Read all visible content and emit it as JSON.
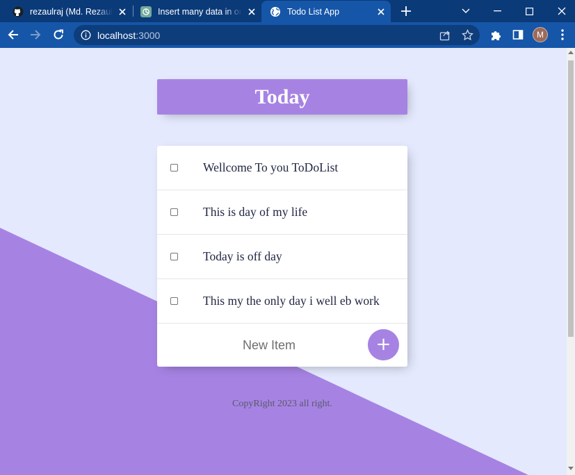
{
  "browser": {
    "tabs": [
      {
        "title": "rezaulraj (Md. Rezaul K",
        "icon": "github-icon"
      },
      {
        "title": "Insert many data in one",
        "icon": "chatgpt-icon"
      },
      {
        "title": "Todo List App",
        "icon": "globe-icon",
        "active": true
      }
    ],
    "url_host": "localhost",
    "url_port": ":3000",
    "profile_initial": "M"
  },
  "page": {
    "title": "Today",
    "items": [
      {
        "text": "Wellcome To you ToDoList",
        "checked": false
      },
      {
        "text": "This is day of my life",
        "checked": false
      },
      {
        "text": "Today is off day",
        "checked": false
      },
      {
        "text": "This my the only day i well eb work",
        "checked": false
      }
    ],
    "new_item_placeholder": "New Item",
    "add_button_label": "+",
    "footer": "CopyRight 2023 all right."
  },
  "colors": {
    "accent": "#a683e3",
    "page_background": "#e4e9fd",
    "browser_frame": "#0b3a79",
    "toolbar": "#1656a8"
  }
}
